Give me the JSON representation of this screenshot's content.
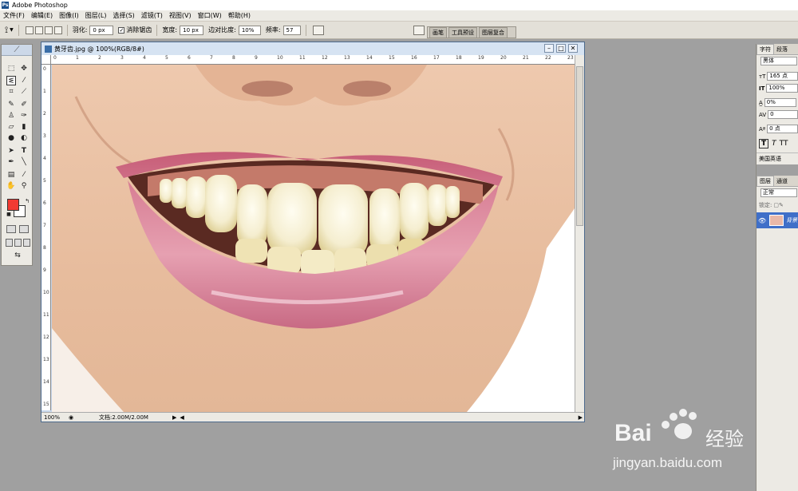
{
  "app": {
    "title": "Adobe Photoshop"
  },
  "menu": [
    "文件(F)",
    "编辑(E)",
    "图像(I)",
    "图层(L)",
    "选择(S)",
    "滤镜(T)",
    "视图(V)",
    "窗口(W)",
    "帮助(H)"
  ],
  "options": {
    "feather_label": "羽化:",
    "feather_value": "0 px",
    "antialias_label": "消除锯齿",
    "width_label": "宽度:",
    "width_value": "10 px",
    "contrast_label": "边对比度:",
    "contrast_value": "10%",
    "frequency_label": "频率:",
    "frequency_value": "57"
  },
  "palette_well": [
    "画笔",
    "工具预设",
    "图层复合"
  ],
  "document": {
    "title": "黄牙齿.jpg @ 100%(RGB/8#)",
    "zoom": "100%",
    "doc_info": "文档:2.00M/2.00M",
    "ruler_h": [
      "0",
      "1",
      "2",
      "3",
      "4",
      "5",
      "6",
      "7",
      "8",
      "9",
      "10",
      "11",
      "12",
      "13",
      "14",
      "15",
      "16",
      "17",
      "18",
      "19",
      "20",
      "21",
      "22",
      "23"
    ],
    "ruler_v": [
      "0",
      "1",
      "2",
      "3",
      "4",
      "5",
      "6",
      "7",
      "8",
      "9",
      "10",
      "11",
      "12",
      "13",
      "14",
      "15"
    ]
  },
  "character_panel": {
    "tabs": [
      "字符",
      "段落"
    ],
    "font": "黑体",
    "size": "165 点",
    "leading": "100%",
    "tracking": "0%",
    "kerning": "0",
    "baseline": "0 点",
    "style_t1": "T",
    "style_t2": "T",
    "style_tt": "TT",
    "language": "美国英语"
  },
  "layers_panel": {
    "tabs": [
      "图层",
      "通道"
    ],
    "mode": "正常",
    "lock_label": "锁定:",
    "layer_name": "背景"
  },
  "watermark": {
    "brand": "Bai",
    "brand2": "经验",
    "url": "jingyan.baidu.com"
  },
  "colors": {
    "foreground": "#f23a32",
    "background": "#ffffff",
    "selection": "#3f6fc8"
  }
}
